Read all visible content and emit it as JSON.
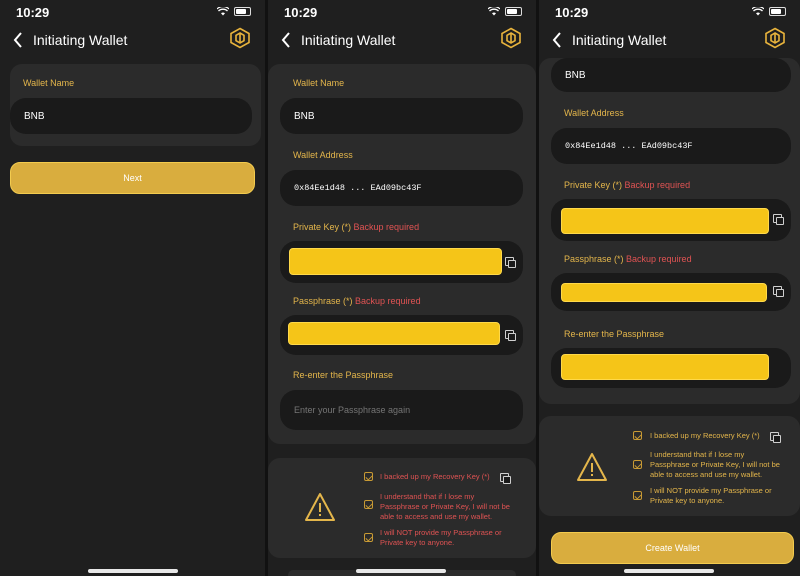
{
  "status": {
    "time": "10:29"
  },
  "nav": {
    "title": "Initiating Wallet",
    "logo_icon": "bnb-logo-icon"
  },
  "colors": {
    "accent": "#e4b64b",
    "button": "#d9ad3e",
    "masked": "#f5c518",
    "warning": "#e05353"
  },
  "form": {
    "wallet_name_label": "Wallet Name",
    "wallet_name_value": "BNB",
    "wallet_address_label": "Wallet Address",
    "wallet_address_value": "0x84Ee1d48 ... EAd09bc43F",
    "private_key_label": "Private Key (*) ",
    "passphrase_label": "Passphrase (*) ",
    "backup_required": "Backup required",
    "reenter_label": "Re-enter the Passphrase",
    "reenter_placeholder": "Enter your Passphrase again"
  },
  "buttons": {
    "next": "Next",
    "create": "Create Wallet"
  },
  "confirmations": [
    {
      "text": "I backed up my Recovery Key (*)"
    },
    {
      "text": "I understand that if I lose my Passphrase or Private Key, I will not be able to access and use my wallet."
    },
    {
      "text": "I will NOT provide my Passphrase or Private key to anyone."
    }
  ]
}
